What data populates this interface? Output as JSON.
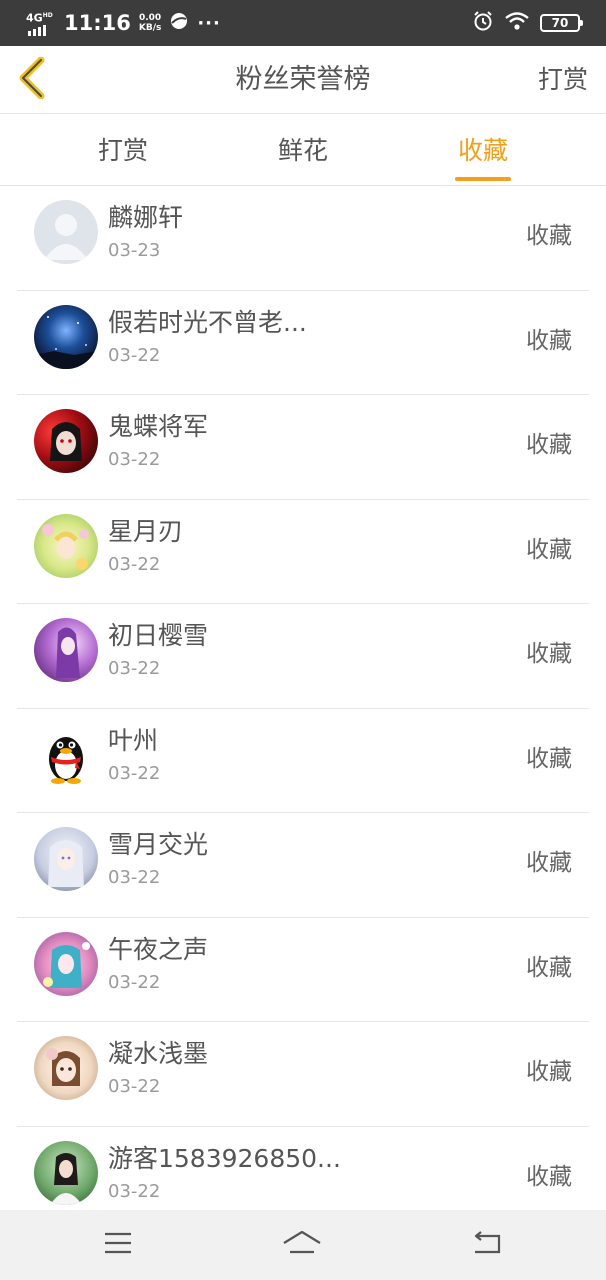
{
  "status_bar": {
    "network": "4G",
    "network_sub": "HD",
    "time": "11:16",
    "speed_value": "0.00",
    "speed_unit": "KB/s",
    "more": "···",
    "battery": "70",
    "icons": [
      "signal-icon",
      "browser-icon",
      "alarm-icon",
      "wifi-icon",
      "battery-icon"
    ]
  },
  "header": {
    "title": "粉丝荣誉榜",
    "action": "打赏",
    "back_icon": "back-chevron-icon"
  },
  "tabs": [
    {
      "label": "打赏",
      "active": false
    },
    {
      "label": "鲜花",
      "active": false
    },
    {
      "label": "收藏",
      "active": true
    }
  ],
  "colors": {
    "accent": "#f0a01a",
    "text": "#555555",
    "subtext": "#9a9a9a",
    "statusbar": "#3c3c3c"
  },
  "fans": [
    {
      "name": "麟娜轩",
      "date": "03-23",
      "type": "收藏",
      "avatar": "default-avatar"
    },
    {
      "name": "假若时光不曾老...",
      "date": "03-22",
      "type": "收藏",
      "avatar": "starry-sky-avatar"
    },
    {
      "name": "鬼蝶将军",
      "date": "03-22",
      "type": "收藏",
      "avatar": "anime-red-avatar"
    },
    {
      "name": "星月刃",
      "date": "03-22",
      "type": "收藏",
      "avatar": "anime-flower-avatar"
    },
    {
      "name": "初日樱雪",
      "date": "03-22",
      "type": "收藏",
      "avatar": "anime-purple-avatar"
    },
    {
      "name": "叶州",
      "date": "03-22",
      "type": "收藏",
      "avatar": "qq-penguin-avatar"
    },
    {
      "name": "雪月交光",
      "date": "03-22",
      "type": "收藏",
      "avatar": "anime-white-avatar"
    },
    {
      "name": "午夜之声",
      "date": "03-22",
      "type": "收藏",
      "avatar": "anime-pink-avatar"
    },
    {
      "name": "凝水浅墨",
      "date": "03-22",
      "type": "收藏",
      "avatar": "doll-avatar"
    },
    {
      "name": "游客1583926850...",
      "date": "03-22",
      "type": "收藏",
      "avatar": "girl-photo-avatar"
    }
  ],
  "navbar": {
    "icons": [
      "menu-icon",
      "home-icon",
      "back-icon"
    ]
  }
}
